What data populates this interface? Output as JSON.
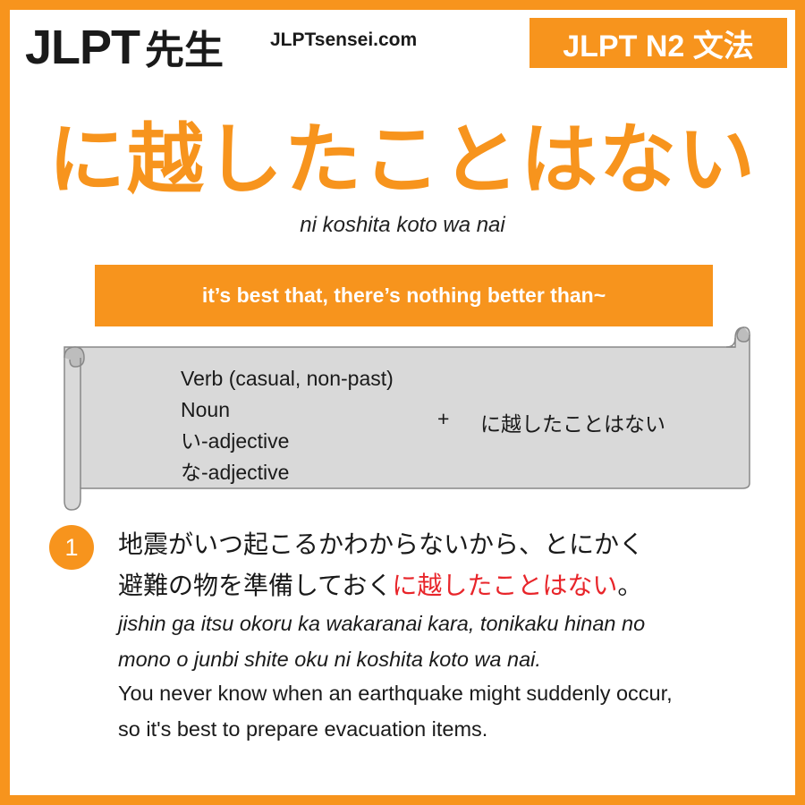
{
  "header": {
    "logo_latin": "JLPT",
    "logo_kanji": "先生",
    "site": "JLPTsensei.com",
    "level": "JLPT N2 文法"
  },
  "grammar": {
    "title": "に越したことはない",
    "romaji": "ni koshita koto wa nai",
    "meaning": "it’s best that, there’s nothing better than~"
  },
  "formation": {
    "forms": [
      "Verb (casual, non-past)",
      "Noun",
      "い-adjective",
      "な-adjective"
    ],
    "plus": "+",
    "pattern": "に越したことはない"
  },
  "example": {
    "number": "1",
    "jp_line1": "地震がいつ起こるかわからないから、とにかく",
    "jp_line2_pre": "避難の物を準備しておく",
    "jp_line2_highlight": "に越したことはない",
    "jp_line2_post": "。",
    "romaji_lines": [
      "jishin ga itsu okoru ka wakaranai kara, tonikaku hinan no",
      "mono o junbi shite oku ni koshita koto wa nai."
    ],
    "english_lines": [
      "You never know when an earthquake might suddenly occur,",
      "so it's best to prepare evacuation items."
    ]
  },
  "colors": {
    "accent": "#f7941d",
    "highlight": "#e8252a",
    "scroll_fill": "#d9d9d9"
  }
}
